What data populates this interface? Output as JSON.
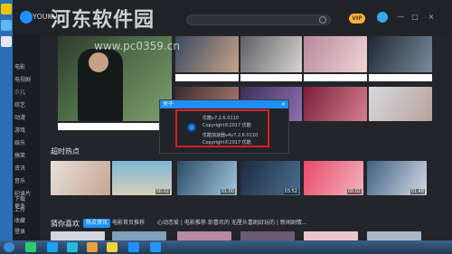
{
  "app": {
    "name": "YOUKU"
  },
  "watermark": {
    "title": "河东软件园",
    "url": "www.pc0359.cn"
  },
  "titlebar": {
    "vip_label": "VIP",
    "minimize": "—",
    "maximize": "□",
    "close": "×"
  },
  "sidebar": {
    "items": [
      {
        "label": "电影"
      },
      {
        "label": "电视剧"
      },
      {
        "label": "少儿"
      },
      {
        "label": "综艺"
      },
      {
        "label": "动漫"
      },
      {
        "label": "游戏"
      },
      {
        "label": "娱乐"
      },
      {
        "label": "搞笑"
      },
      {
        "label": "资讯"
      },
      {
        "label": "音乐"
      },
      {
        "label": "纪录片"
      },
      {
        "label": "更多"
      },
      {
        "label": "下载"
      },
      {
        "label": "上传"
      },
      {
        "label": "收藏"
      },
      {
        "label": "登录"
      }
    ]
  },
  "sections": {
    "hot": {
      "title": "超时热点"
    },
    "guess": {
      "title": "猜你喜欢",
      "chips": [
        {
          "label": "热点资讯"
        },
        {
          "label": "电影首页推荐"
        },
        {
          "label": "心动恋爱 | 电影推荐..."
        },
        {
          "label": "你喜欢的 无厘头喜剧..."
        },
        {
          "label": "好玩的 | 新闻剧情..."
        }
      ]
    }
  },
  "hot_clips": [
    {
      "time": ""
    },
    {
      "time": "00:02"
    },
    {
      "time": "01:00"
    },
    {
      "time": "03:52"
    },
    {
      "time": "00:02"
    },
    {
      "time": "01:48"
    }
  ],
  "dialog": {
    "title": "关于",
    "close": "×",
    "line1": "优酷v7.2.6.0110",
    "line2": "Copyright©2017 优酷",
    "line3": "优酷加速器v4v7.2.6.0110",
    "line4": "Copyright©2017 优酷"
  },
  "taskbar": {
    "time": ""
  }
}
